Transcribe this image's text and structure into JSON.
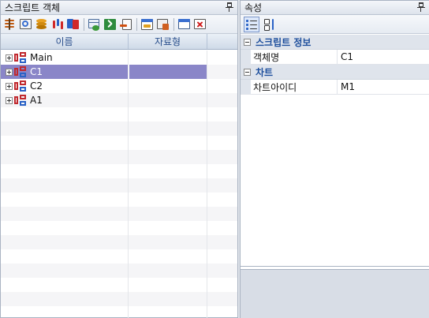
{
  "left_panel": {
    "title": "스크립트 객체",
    "toolbar_icons": [
      "properties-icon",
      "find-icon",
      "database-icon",
      "candle-chart-icon",
      "compare-icon",
      "table-add-icon",
      "excel-icon",
      "arrow-import-icon",
      "calendar-icon",
      "grid-edit-icon",
      "window-icon",
      "delete-icon"
    ],
    "columns": {
      "name": "이름",
      "type": "자료형"
    },
    "rows": [
      {
        "label": "Main",
        "selected": false
      },
      {
        "label": "C1",
        "selected": true
      },
      {
        "label": "C2",
        "selected": false
      },
      {
        "label": "A1",
        "selected": false
      }
    ]
  },
  "right_panel": {
    "title": "속성",
    "categories": [
      {
        "name": "스크립트 정보",
        "props": [
          {
            "name": "객체명",
            "value": "C1"
          }
        ]
      },
      {
        "name": "차트",
        "props": [
          {
            "name": "차트아이디",
            "value": "M1"
          }
        ]
      }
    ]
  },
  "colors": {
    "selection": "#8a86c8",
    "category_text": "#1d4e9c",
    "icon_red": "#c0282d",
    "icon_blue": "#2a62c6"
  }
}
